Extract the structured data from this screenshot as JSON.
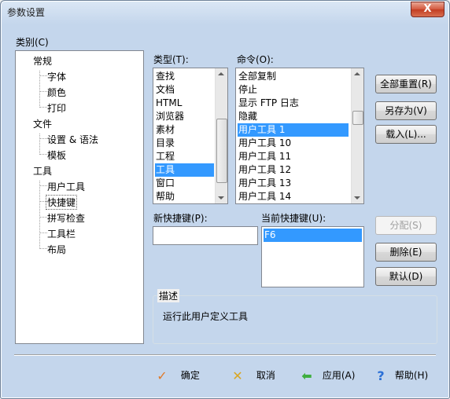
{
  "window": {
    "title": "参数设置",
    "close_label": "X"
  },
  "category": {
    "label": "类别(C)",
    "items": [
      {
        "label": "常规"
      },
      {
        "label": "字体"
      },
      {
        "label": "颜色"
      },
      {
        "label": "打印"
      },
      {
        "label": "文件"
      },
      {
        "label": "设置 & 语法"
      },
      {
        "label": "模板"
      },
      {
        "label": "工具"
      },
      {
        "label": "用户工具"
      },
      {
        "label": "快捷键"
      },
      {
        "label": "拼写检查"
      },
      {
        "label": "工具栏"
      },
      {
        "label": "布局"
      }
    ]
  },
  "types": {
    "label": "类型(T):",
    "items": [
      "查找",
      "文档",
      "HTML",
      "浏览器",
      "素材",
      "目录",
      "工程",
      "工具",
      "窗口",
      "帮助"
    ],
    "selected": "工具"
  },
  "commands": {
    "label": "命令(O):",
    "items": [
      "全部复制",
      "停止",
      "显示 FTP 日志",
      "隐藏",
      "用户工具 1",
      "用户工具 10",
      "用户工具 11",
      "用户工具 12",
      "用户工具 13",
      "用户工具 14"
    ],
    "selected": "用户工具 1"
  },
  "new_shortcut": {
    "label": "新快捷键(P):",
    "value": ""
  },
  "current_shortcut": {
    "label": "当前快捷键(U):",
    "items": [
      "F6"
    ]
  },
  "right_buttons": {
    "reset_all": "全部重置(R)",
    "save_as": "另存为(V)",
    "load": "载入(L)...",
    "assign": "分配(S)",
    "delete": "删除(E)",
    "default": "默认(D)"
  },
  "description": {
    "label": "描述",
    "text": "运行此用户定义工具"
  },
  "footer": {
    "ok": "确定",
    "cancel": "取消",
    "apply": "应用(A)",
    "help": "帮助(H)"
  },
  "colors": {
    "selection": "#3399ff",
    "title_bar": "#c4d6ec",
    "close_button": "#c23d22"
  }
}
